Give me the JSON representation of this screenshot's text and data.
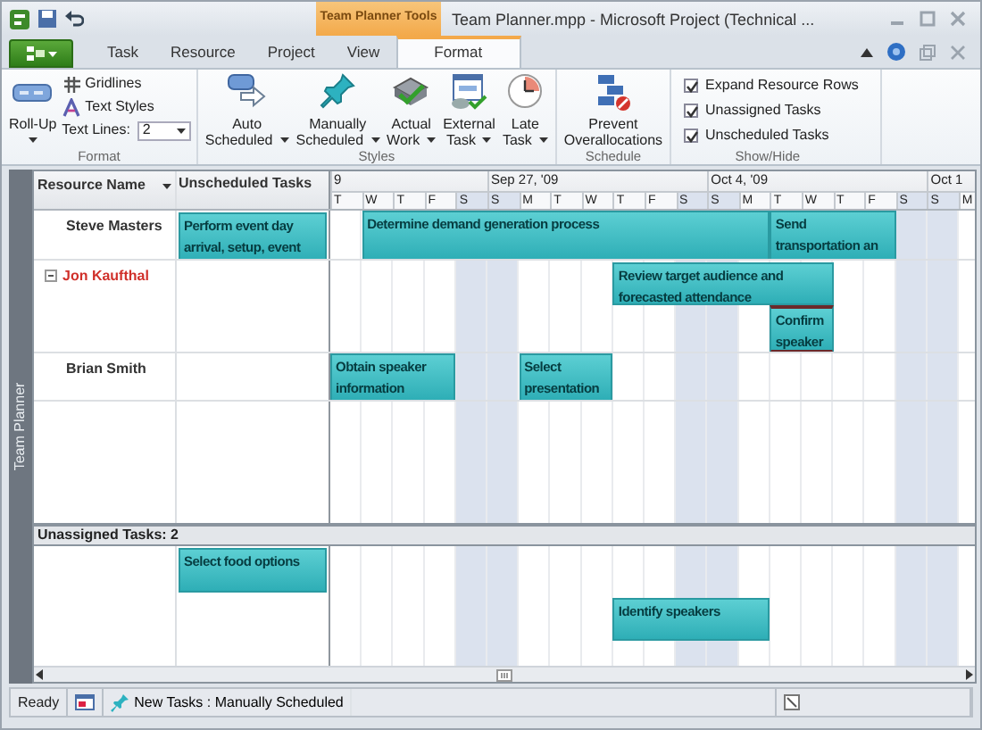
{
  "window": {
    "title": "Team Planner.mpp  -  Microsoft Project (Technical ...",
    "contextual_tab": "Team Planner Tools"
  },
  "tabs": [
    {
      "label": "Task",
      "selected": false
    },
    {
      "label": "Resource",
      "selected": false
    },
    {
      "label": "Project",
      "selected": false
    },
    {
      "label": "View",
      "selected": false
    },
    {
      "label": "Format",
      "selected": true
    }
  ],
  "ribbon": [
    {
      "label": "Format",
      "items": [
        {
          "kind": "large",
          "label": "Roll-Up",
          "dropdown": true
        },
        {
          "kind": "small",
          "label": "Gridlines"
        },
        {
          "kind": "small",
          "label": "Text Styles"
        },
        {
          "kind": "spin",
          "label": "Text Lines:",
          "value": "2"
        }
      ]
    },
    {
      "label": "Styles",
      "items": [
        {
          "kind": "large",
          "label": "Auto Scheduled",
          "dropdown": true
        },
        {
          "kind": "large",
          "label": "Manually Scheduled",
          "dropdown": true
        },
        {
          "kind": "large",
          "label": "Actual Work",
          "dropdown": true
        },
        {
          "kind": "large",
          "label": "External Task",
          "dropdown": true
        },
        {
          "kind": "large",
          "label": "Late Task",
          "dropdown": true
        }
      ]
    },
    {
      "label": "Schedule",
      "items": [
        {
          "kind": "large",
          "label": "Prevent Overallocations",
          "dropdown": false
        }
      ]
    },
    {
      "label": "Show/Hide",
      "items": [
        {
          "kind": "check",
          "label": "Expand Resource Rows",
          "checked": true
        },
        {
          "kind": "check",
          "label": "Unassigned Tasks",
          "checked": true
        },
        {
          "kind": "check",
          "label": "Unscheduled Tasks",
          "checked": true
        }
      ]
    }
  ],
  "view_label": "Team Planner",
  "columns": [
    {
      "label": "Resource Name",
      "sort_menu": true
    },
    {
      "label": "Unscheduled Tasks",
      "sort_menu": false
    }
  ],
  "timescale": {
    "weeks": [
      {
        "label": "9"
      },
      {
        "label": "Sep 27, '09"
      },
      {
        "label": "Oct 4, '09"
      },
      {
        "label": "Oct 1"
      }
    ],
    "days": [
      {
        "label": "T",
        "weekend": false
      },
      {
        "label": "W",
        "weekend": false
      },
      {
        "label": "T",
        "weekend": false
      },
      {
        "label": "F",
        "weekend": false
      },
      {
        "label": "S",
        "weekend": true
      },
      {
        "label": "S",
        "weekend": true
      },
      {
        "label": "M",
        "weekend": false
      },
      {
        "label": "T",
        "weekend": false
      },
      {
        "label": "W",
        "weekend": false
      },
      {
        "label": "T",
        "weekend": false
      },
      {
        "label": "F",
        "weekend": false
      },
      {
        "label": "S",
        "weekend": true
      },
      {
        "label": "S",
        "weekend": true
      },
      {
        "label": "M",
        "weekend": false
      },
      {
        "label": "T",
        "weekend": false
      },
      {
        "label": "W",
        "weekend": false
      },
      {
        "label": "T",
        "weekend": false
      },
      {
        "label": "F",
        "weekend": false
      },
      {
        "label": "S",
        "weekend": true
      },
      {
        "label": "S",
        "weekend": true
      },
      {
        "label": "M",
        "weekend": false
      }
    ]
  },
  "resources": [
    {
      "name": "Steve Masters",
      "overallocated": false,
      "unscheduled": [
        {
          "name": "Perform event day arrival, setup, event"
        }
      ],
      "tasks": [
        {
          "name": "Determine demand generation process",
          "overallocated": false
        },
        {
          "name": "Send transportation an",
          "overallocated": false
        }
      ]
    },
    {
      "name": "Jon Kaufthal",
      "overallocated": true,
      "expanded": true,
      "tasks": [
        {
          "name": "Review target audience and forecasted attendance",
          "overallocated": false
        },
        {
          "name": "Confirm speaker",
          "overallocated": true
        }
      ]
    },
    {
      "name": "Brian Smith",
      "overallocated": false,
      "tasks": [
        {
          "name": "Obtain speaker information",
          "overallocated": false
        },
        {
          "name": "Select presentation",
          "overallocated": false
        }
      ]
    }
  ],
  "unassigned": {
    "label": "Unassigned Tasks: 2",
    "unscheduled": [
      {
        "name": "Select food options"
      }
    ],
    "tasks": [
      {
        "name": "Identify speakers",
        "overallocated": false
      }
    ]
  },
  "status_bar": {
    "mode": "Ready",
    "new_tasks": "New Tasks : Manually Scheduled"
  }
}
